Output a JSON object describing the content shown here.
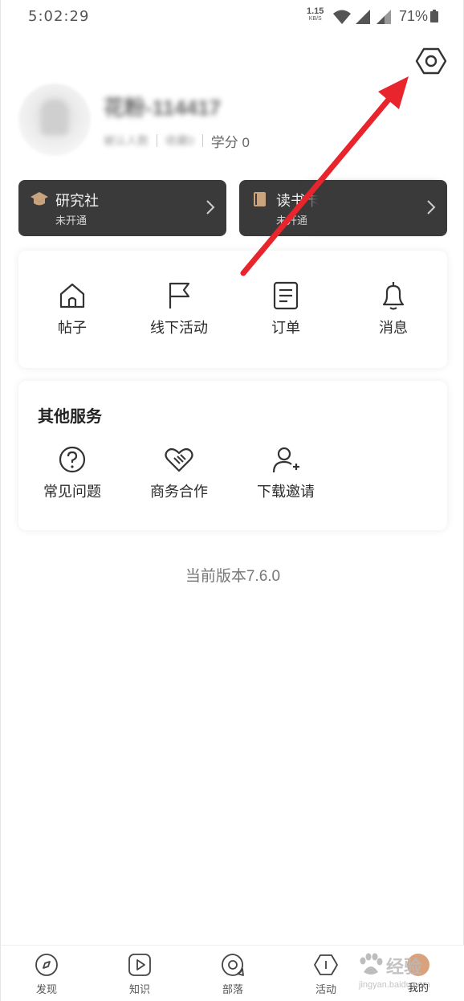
{
  "status_bar": {
    "time": "5:02:29",
    "net_speed": "1.15",
    "net_unit": "KB/S",
    "battery": "71%"
  },
  "profile": {
    "nickname": "花粉-114417",
    "tag_1": "被认人数",
    "tag_2": "收藏0",
    "credit": "学分 0"
  },
  "memberships": [
    {
      "title": "研究社",
      "status": "未开通",
      "icon": "graduation-cap-icon"
    },
    {
      "title": "读书卡",
      "status": "未开通",
      "icon": "book-icon"
    }
  ],
  "main_entries": [
    {
      "label": "帖子",
      "icon": "home-icon"
    },
    {
      "label": "线下活动",
      "icon": "flag-icon"
    },
    {
      "label": "订单",
      "icon": "document-icon"
    },
    {
      "label": "消息",
      "icon": "bell-icon"
    }
  ],
  "other_services": {
    "heading": "其他服务",
    "items": [
      {
        "label": "常见问题",
        "icon": "question-icon"
      },
      {
        "label": "商务合作",
        "icon": "handshake-heart-icon"
      },
      {
        "label": "下载邀请",
        "icon": "add-user-icon"
      }
    ]
  },
  "version": "当前版本7.6.0",
  "tabs": [
    {
      "label": "发现",
      "icon": "compass-icon"
    },
    {
      "label": "知识",
      "icon": "play-icon"
    },
    {
      "label": "部落",
      "icon": "chat-circle-icon"
    },
    {
      "label": "活动",
      "icon": "hexagon-icon"
    },
    {
      "label": "我的",
      "icon": "avatar-icon"
    }
  ],
  "watermark": {
    "line1": "经验",
    "line2": "jingyan.baidu.com"
  },
  "colors": {
    "card_dark": "#3a3a3a",
    "annotation_arrow": "#e8242c",
    "avatar_accent": "#d9a27d"
  }
}
